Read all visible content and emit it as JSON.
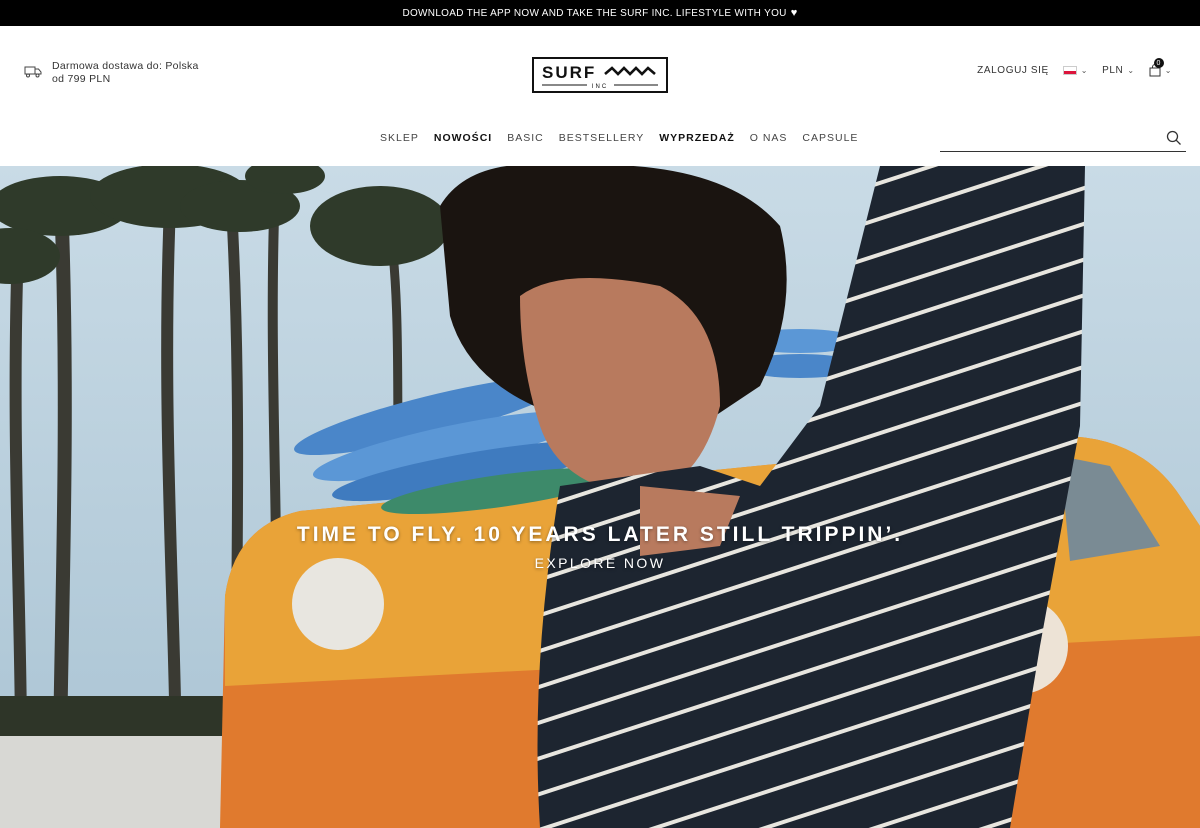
{
  "banner": {
    "text": "DOWNLOAD THE APP NOW AND TAKE THE SURF INC. LIFESTYLE WITH YOU",
    "heart": "♥"
  },
  "shipping": {
    "line1": "Darmowa dostawa do: Polska",
    "line2": "od 799 PLN"
  },
  "logo": {
    "word": "SURF",
    "sub": "INC"
  },
  "tools": {
    "login": "ZALOGUJ SIĘ",
    "currency": "PLN",
    "cart_count": "0",
    "chevron": "⌄"
  },
  "nav": {
    "items": [
      {
        "label": "SKLEP",
        "bold": false
      },
      {
        "label": "NOWOŚCI",
        "bold": true
      },
      {
        "label": "BASIC",
        "bold": false
      },
      {
        "label": "BESTSELLERY",
        "bold": false
      },
      {
        "label": "WYPRZEDAŻ",
        "bold": true
      },
      {
        "label": "O NAS",
        "bold": false
      },
      {
        "label": "CAPSULE",
        "bold": false
      }
    ]
  },
  "search": {
    "value": "",
    "placeholder": ""
  },
  "hero": {
    "title": "TIME TO FLY. 10 YEARS LATER STILL TRIPPIN’.",
    "cta": "EXPLORE NOW"
  },
  "colors": {
    "banner_bg": "#000000",
    "flag_red": "#dc143c",
    "van_orange": "#e07a2e"
  },
  "icons": [
    "truck-icon",
    "search-icon",
    "bag-icon",
    "poland-flag-icon",
    "chevron-down-icon"
  ]
}
